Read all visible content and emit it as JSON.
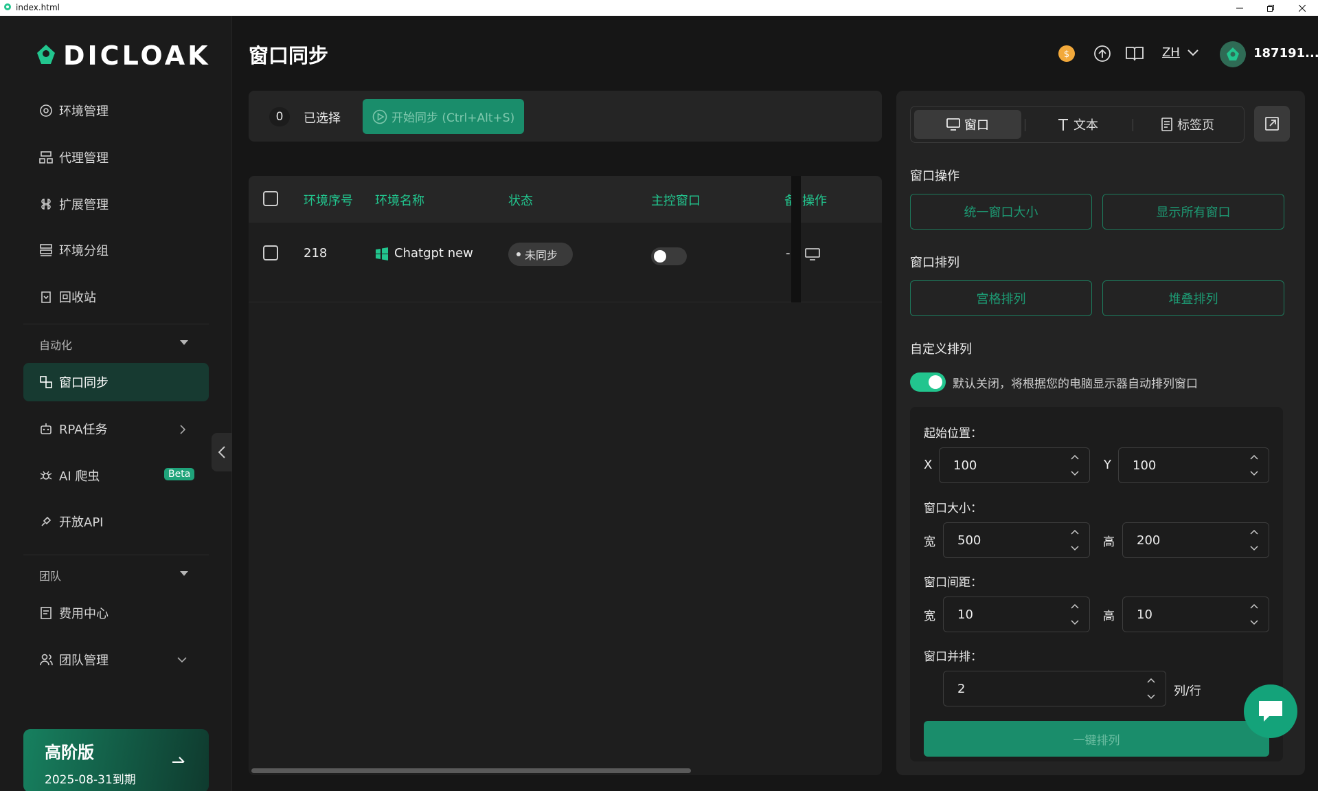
{
  "window": {
    "title": "index.html"
  },
  "brand": {
    "name": "DICLOAK",
    "accent": "#22c58e"
  },
  "sidebar": {
    "items": [
      {
        "label": "环境管理",
        "icon": "chrome-icon"
      },
      {
        "label": "代理管理",
        "icon": "proxy-icon"
      },
      {
        "label": "扩展管理",
        "icon": "extension-icon"
      },
      {
        "label": "环境分组",
        "icon": "group-icon"
      },
      {
        "label": "回收站",
        "icon": "trash-icon"
      }
    ],
    "automation_label": "自动化",
    "automation_items": [
      {
        "label": "窗口同步",
        "icon": "window-sync-icon"
      },
      {
        "label": "RPA任务",
        "icon": "robot-icon"
      },
      {
        "label": "AI 爬虫",
        "icon": "spider-icon",
        "badge": "Beta"
      },
      {
        "label": "开放API",
        "icon": "api-icon"
      }
    ],
    "team_label": "团队",
    "team_items": [
      {
        "label": "费用中心",
        "icon": "billing-icon"
      },
      {
        "label": "团队管理",
        "icon": "team-icon"
      }
    ],
    "plan": {
      "name": "高阶版",
      "expiry": "2025-08-31到期"
    }
  },
  "header": {
    "title": "窗口同步",
    "lang": "ZH",
    "user": "187191..."
  },
  "toolbar": {
    "selected_count": "0",
    "selected_label": "已选择",
    "sync_label": "开始同步 (Ctrl+Alt+S)"
  },
  "table": {
    "columns": [
      "环境序号",
      "环境名称",
      "状态",
      "主控窗口",
      "备",
      "操作"
    ],
    "rows": [
      {
        "id": "218",
        "name": "Chatgpt new",
        "status": "未同步",
        "master": false,
        "note": "-"
      }
    ]
  },
  "panel": {
    "tabs": [
      {
        "label": "窗口"
      },
      {
        "label": "文本"
      },
      {
        "label": "标签页"
      }
    ],
    "window_ops_label": "窗口操作",
    "unify_size": "统一窗口大小",
    "show_all": "显示所有窗口",
    "arrange_label": "窗口排列",
    "grid": "宫格排列",
    "stack": "堆叠排列",
    "custom_label": "自定义排列",
    "custom_hint": "默认关闭，将根据您的电脑显示器自动排列窗口",
    "custom_enabled": true,
    "start_pos_label": "起始位置：",
    "x_label": "X",
    "x": "100",
    "y_label": "Y",
    "y": "100",
    "size_label": "窗口大小：",
    "width_label": "宽",
    "width": "500",
    "height_label": "高",
    "height": "200",
    "gap_label": "窗口间距：",
    "gap_w_label": "宽",
    "gap_w": "10",
    "gap_h_label": "高",
    "gap_h": "10",
    "cols_label": "窗口并排：",
    "cols": "2",
    "cols_unit": "列/行",
    "apply": "一键排列"
  }
}
